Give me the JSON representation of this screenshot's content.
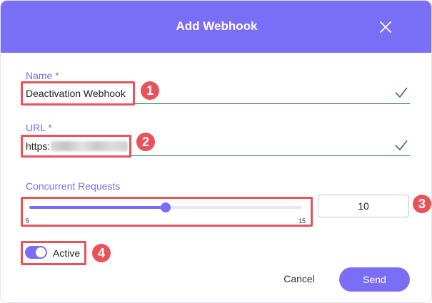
{
  "dialog": {
    "title": "Add Webhook",
    "close_icon": "close-icon"
  },
  "fields": {
    "name": {
      "label": "Name *",
      "value": "Deactivation Webhook",
      "valid_icon": "check-icon"
    },
    "url": {
      "label": "URL *",
      "value_visible": "https:",
      "valid_icon": "check-icon"
    },
    "concurrent_requests": {
      "label": "Concurrent Requests",
      "min": "5",
      "max": "15",
      "value": "10",
      "level": 10
    }
  },
  "active": {
    "label": "Active",
    "enabled": true
  },
  "actions": {
    "cancel_label": "Cancel",
    "send_label": "Send"
  },
  "callouts": [
    "1",
    "2",
    "3",
    "4"
  ],
  "colors": {
    "accent": "#7b6ef6",
    "valid": "#2f7d3b",
    "callout": "#e8525a"
  }
}
